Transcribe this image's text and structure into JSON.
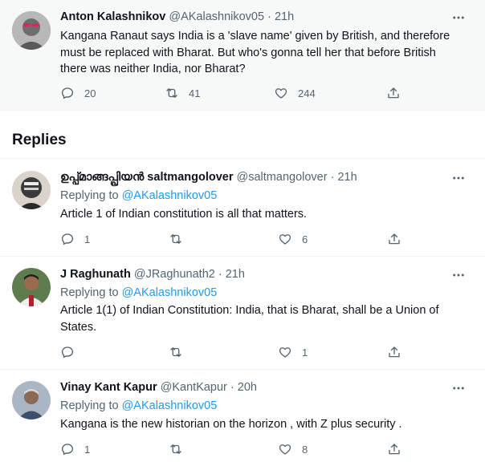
{
  "main_tweet": {
    "author_name": "Anton Kalashnikov",
    "handle": "@AKalashnikov05",
    "time": "21h",
    "text": "Kangana Ranaut says India is a 'slave name' given by British, and therefore must be replaced with Bharat. But who's gonna tell her that before British there was neither India, nor Bharat?",
    "reply_count": "20",
    "retweet_count": "41",
    "like_count": "244",
    "icons": [
      "more-icon",
      "reply-icon",
      "retweet-icon",
      "like-icon",
      "share-icon"
    ]
  },
  "replies_header": "Replies",
  "replying_to_label": "Replying to",
  "replies": [
    {
      "author_name": "ഉപ്പ്മാങ്ങപ്പ്രിയൻ saltmangolover",
      "handle": "@saltmangolover",
      "time": "21h",
      "replying_to": "@AKalashnikov05",
      "text": "Article 1 of Indian constitution is all that matters.",
      "reply_count": "1",
      "retweet_count": "",
      "like_count": "6"
    },
    {
      "author_name": "J Raghunath",
      "handle": "@JRaghunath2",
      "time": "21h",
      "replying_to": "@AKalashnikov05",
      "text": "Article 1(1) of Indian Constitution: India, that is Bharat, shall be a Union of States.",
      "reply_count": "",
      "retweet_count": "",
      "like_count": "1"
    },
    {
      "author_name": "Vinay Kant Kapur",
      "handle": "@KantKapur",
      "time": "20h",
      "replying_to": "@AKalashnikov05",
      "text": "Kangana is the new historian on the horizon , with Z plus security .",
      "reply_count": "1",
      "retweet_count": "",
      "like_count": "8"
    }
  ],
  "meta_separator": "·",
  "colors": {
    "link": "#1d9bf0",
    "muted": "#536471",
    "text": "#0f1419",
    "highlight_bg": "#f7f9f9"
  }
}
